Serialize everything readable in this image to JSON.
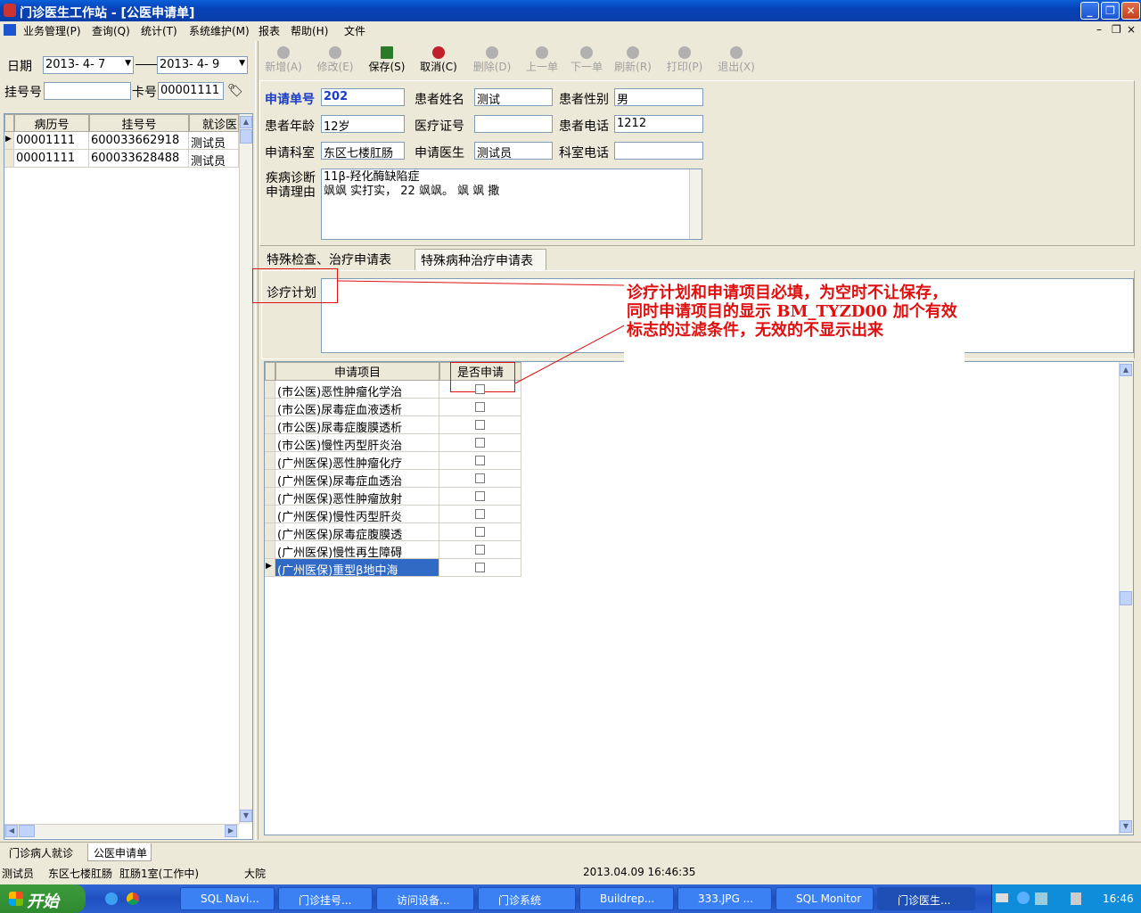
{
  "window": {
    "title": "门诊医生工作站 - [公医申请单]"
  },
  "menu": [
    "业务管理(P)",
    "查询(Q)",
    "统计(T)",
    "系统维护(M)",
    "报表",
    "帮助(H)",
    "文件"
  ],
  "left": {
    "date_label": "日期",
    "date_from": "2013- 4- 7",
    "date_to": "2013- 4- 9",
    "reg_label": "挂号号",
    "reg_value": "",
    "card_label": "卡号",
    "card_value": "00001111",
    "cols": [
      "病历号",
      "挂号号",
      "就诊医"
    ],
    "rows": [
      [
        "00001111",
        "600033662918",
        "测试员"
      ],
      [
        "00001111",
        "600033628488",
        "测试员"
      ]
    ]
  },
  "toolbar": [
    {
      "label": "新增(A)"
    },
    {
      "label": "修改(E)"
    },
    {
      "label": "保存(S)"
    },
    {
      "label": "取消(C)"
    },
    {
      "label": "删除(D)"
    },
    {
      "label": "上一单"
    },
    {
      "label": "下一单"
    },
    {
      "label": "刷新(R)"
    },
    {
      "label": "打印(P)"
    },
    {
      "label": "退出(X)"
    }
  ],
  "form": {
    "apply_no_label": "申请单号",
    "apply_no": "202",
    "patient_name_label": "患者姓名",
    "patient_name": "测试",
    "gender_label": "患者性别",
    "gender": "男",
    "age_label": "患者年龄",
    "age": "12岁",
    "med_cert_label": "医疗证号",
    "med_cert": "",
    "phone_label": "患者电话",
    "phone": "1212",
    "dept_label": "申请科室",
    "dept": "东区七楼肛肠",
    "doctor_label": "申请医生",
    "doctor": "测试员",
    "dept_phone_label": "科室电话",
    "dept_phone": "",
    "diag_label": "疾病诊断",
    "reason_label": "申请理由",
    "diag_text": "11β-羟化酶缺陷症",
    "reason_text": "飒飒  实打实，    22 飒飒。  飒   飒 撒"
  },
  "tabs": [
    "特殊检查、治疗申请表",
    "特殊病种治疗申请表"
  ],
  "plan_label": "诊疗计划",
  "annotation": "诊疗计划和申请项目必填，为空时不让保存，同时申请项目的显示 BM_TYZD00 加个有效标志的过滤条件，无效的不显示出来",
  "items": {
    "cols": [
      "申请项目",
      "是否申请"
    ],
    "rows": [
      "(市公医)恶性肿瘤化学治",
      "(市公医)尿毒症血液透析",
      "(市公医)尿毒症腹膜透析",
      "(市公医)慢性丙型肝炎治",
      "(广州医保)恶性肿瘤化疗",
      "(广州医保)尿毒症血透治",
      "(广州医保)恶性肿瘤放射",
      "(广州医保)慢性丙型肝炎",
      "(广州医保)尿毒症腹膜透",
      "(广州医保)慢性再生障碍",
      "(广州医保)重型β地中海"
    ]
  },
  "bottom_tabs": [
    "门诊病人就诊",
    "公医申请单"
  ],
  "status": [
    "测试员",
    "东区七楼肛肠",
    "肛肠1室(工作中)",
    "大院",
    "",
    "2013.04.09 16:46:35"
  ],
  "taskbar": {
    "start": "开始",
    "tasks": [
      "SQL Navi...",
      "门诊挂号...",
      "访问设备...",
      "门诊系统",
      "Buildrep...",
      "333.JPG ...",
      "SQL Monitor",
      "门诊医生..."
    ],
    "clock": "16:46"
  }
}
